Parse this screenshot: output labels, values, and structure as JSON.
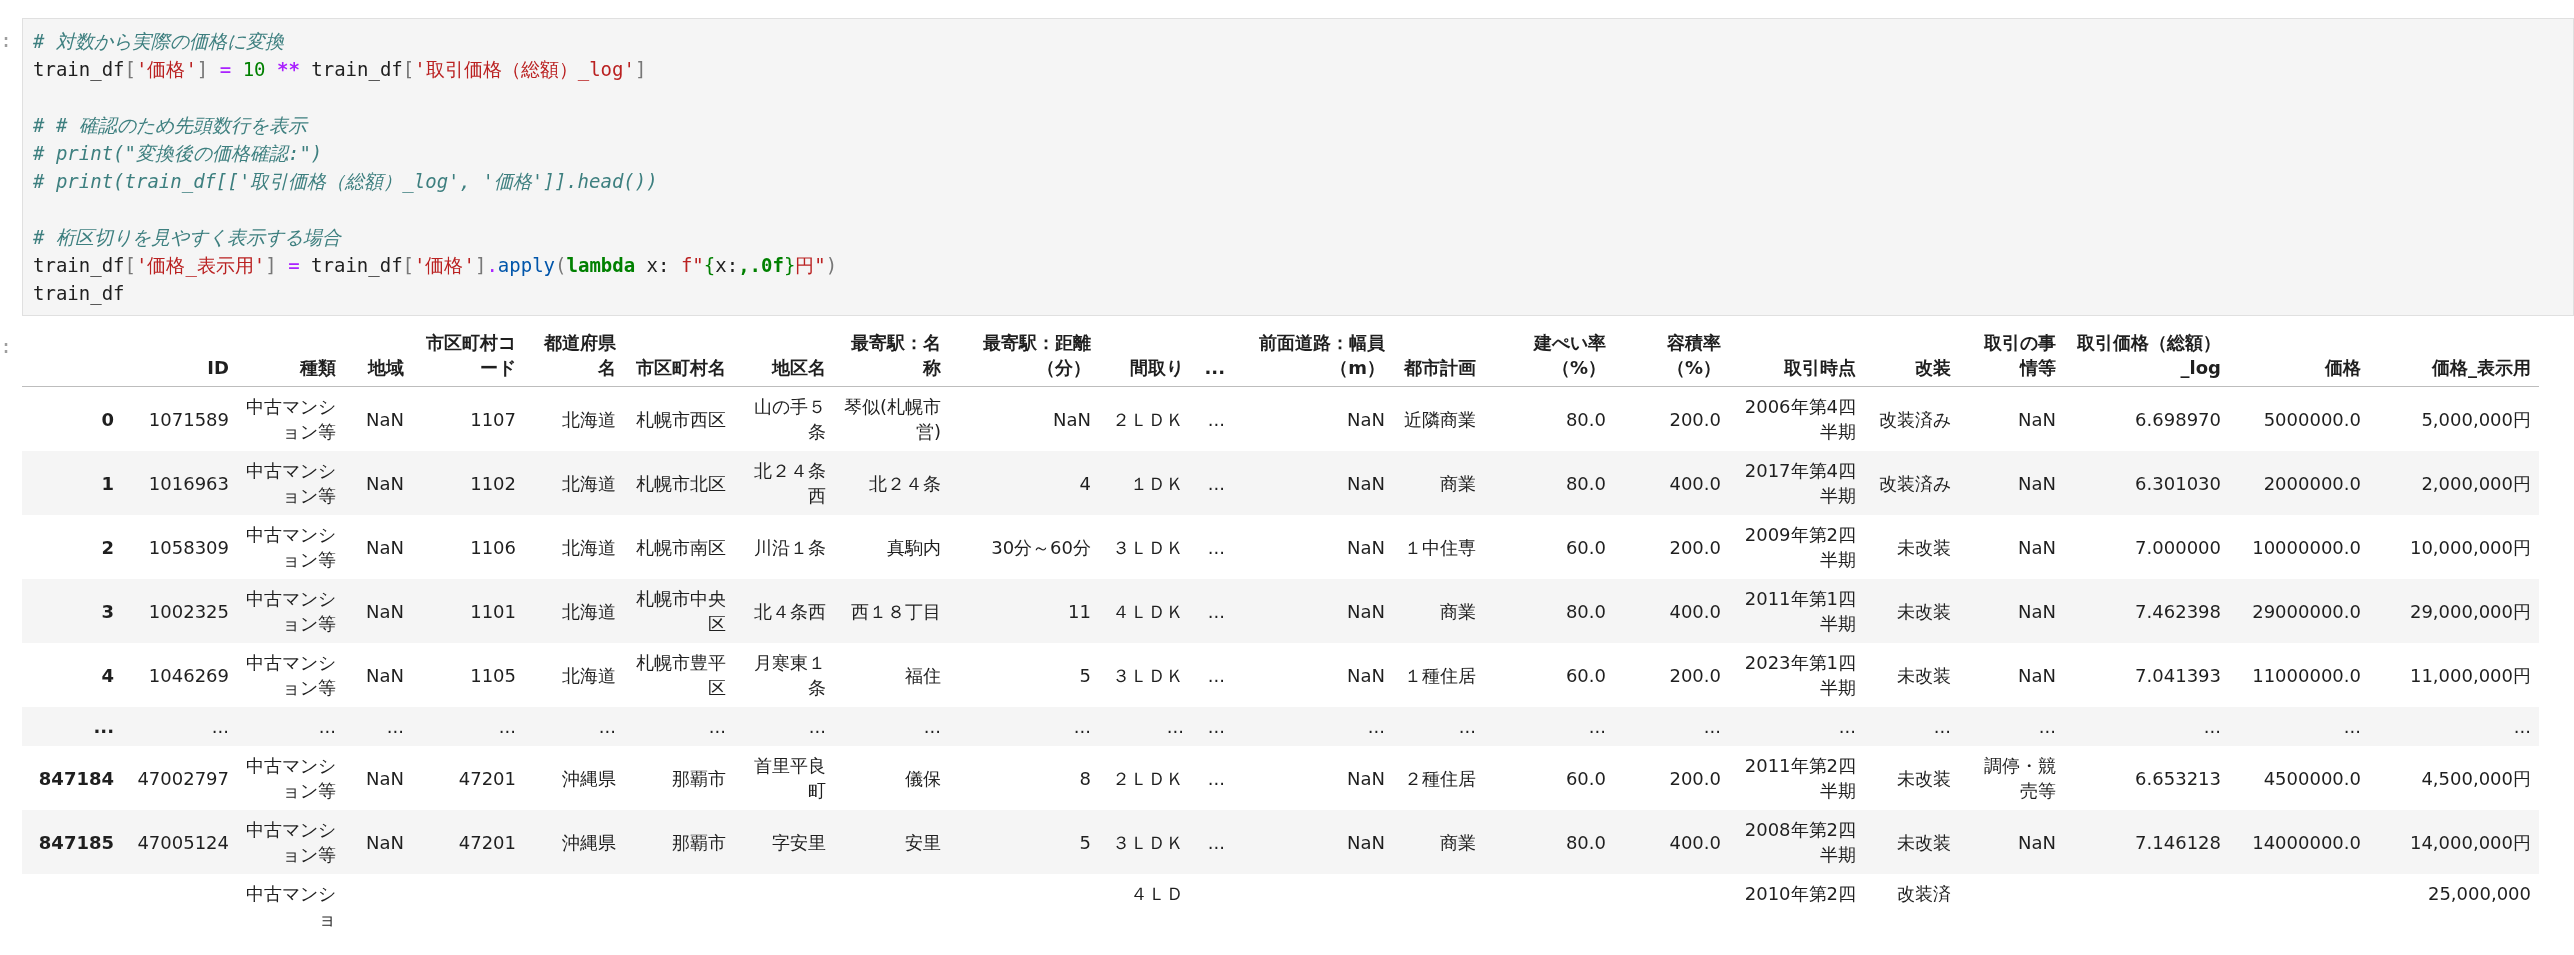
{
  "code_cell": {
    "prompt": ":",
    "lines": [
      {
        "kind": "code",
        "tokens": [
          {
            "kind": "comment",
            "text": "# 対数から実際の価格に変換"
          }
        ]
      },
      {
        "kind": "code",
        "tokens": [
          {
            "kind": "name",
            "text": "train_df"
          },
          {
            "kind": "punct",
            "text": "["
          },
          {
            "kind": "string",
            "text": "'価格'"
          },
          {
            "kind": "punct",
            "text": "]"
          },
          {
            "kind": "op",
            "text": " = "
          },
          {
            "kind": "number",
            "text": "10"
          },
          {
            "kind": "power",
            "text": " ** "
          },
          {
            "kind": "name",
            "text": "train_df"
          },
          {
            "kind": "punct",
            "text": "["
          },
          {
            "kind": "string",
            "text": "'取引価格（総額）_log'"
          },
          {
            "kind": "punct",
            "text": "]"
          }
        ]
      },
      {
        "kind": "blank"
      },
      {
        "kind": "code",
        "tokens": [
          {
            "kind": "comment",
            "text": "# # 確認のため先頭数行を表示"
          }
        ]
      },
      {
        "kind": "code",
        "tokens": [
          {
            "kind": "comment",
            "text": "# print(\"変換後の価格確認:\")"
          }
        ]
      },
      {
        "kind": "code",
        "tokens": [
          {
            "kind": "comment",
            "text": "# print(train_df[['取引価格（総額）_log', '価格']].head())"
          }
        ]
      },
      {
        "kind": "blank"
      },
      {
        "kind": "code",
        "tokens": [
          {
            "kind": "comment",
            "text": "# 桁区切りを見やすく表示する場合"
          }
        ]
      },
      {
        "kind": "code",
        "tokens": [
          {
            "kind": "name",
            "text": "train_df"
          },
          {
            "kind": "punct",
            "text": "["
          },
          {
            "kind": "string",
            "text": "'価格_表示用'"
          },
          {
            "kind": "punct",
            "text": "]"
          },
          {
            "kind": "op",
            "text": " = "
          },
          {
            "kind": "name",
            "text": "train_df"
          },
          {
            "kind": "punct",
            "text": "["
          },
          {
            "kind": "string",
            "text": "'価格'"
          },
          {
            "kind": "punct",
            "text": "]"
          },
          {
            "kind": "op",
            "text": "."
          },
          {
            "kind": "attr",
            "text": "apply"
          },
          {
            "kind": "punct",
            "text": "("
          },
          {
            "kind": "keyword",
            "text": "lambda"
          },
          {
            "kind": "name",
            "text": " x: "
          },
          {
            "kind": "string",
            "text": "f\""
          },
          {
            "kind": "interp",
            "text": "{"
          },
          {
            "kind": "name",
            "text": "x:"
          },
          {
            "kind": "format",
            "text": ",.0f"
          },
          {
            "kind": "interp",
            "text": "}"
          },
          {
            "kind": "string",
            "text": "円\""
          },
          {
            "kind": "punct",
            "text": ")"
          }
        ]
      },
      {
        "kind": "code",
        "tokens": [
          {
            "kind": "name",
            "text": "train_df"
          }
        ]
      }
    ]
  },
  "output": {
    "prompt": ":",
    "table": {
      "columns": [
        "ID",
        "種類",
        "地域",
        "市区町村コード",
        "都道府県名",
        "市区町村名",
        "地区名",
        "最寄駅：名称",
        "最寄駅：距離（分）",
        "間取り",
        "...",
        "前面道路：幅員（m）",
        "都市計画",
        "建ぺい率（%）",
        "容積率（%）",
        "取引時点",
        "改装",
        "取引の事情等",
        "取引価格（総額）_log",
        "価格",
        "価格_表示用"
      ],
      "rows": [
        {
          "cut_off": false,
          "index": "0",
          "cells": [
            "1071589",
            "中古マンション等",
            "NaN",
            "1107",
            "北海道",
            "札幌市西区",
            "山の手５条",
            "琴似(札幌市営)",
            "NaN",
            "２ＬＤＫ",
            "...",
            "NaN",
            "近隣商業",
            "80.0",
            "200.0",
            "2006年第4四半期",
            "改装済み",
            "NaN",
            "6.698970",
            "5000000.0",
            "5,000,000円"
          ]
        },
        {
          "cut_off": false,
          "index": "1",
          "cells": [
            "1016963",
            "中古マンション等",
            "NaN",
            "1102",
            "北海道",
            "札幌市北区",
            "北２４条西",
            "北２４条",
            "4",
            "１ＤＫ",
            "...",
            "NaN",
            "商業",
            "80.0",
            "400.0",
            "2017年第4四半期",
            "改装済み",
            "NaN",
            "6.301030",
            "2000000.0",
            "2,000,000円"
          ]
        },
        {
          "cut_off": false,
          "index": "2",
          "cells": [
            "1058309",
            "中古マンション等",
            "NaN",
            "1106",
            "北海道",
            "札幌市南区",
            "川沿１条",
            "真駒内",
            "30分～60分",
            "３ＬＤＫ",
            "...",
            "NaN",
            "１中住専",
            "60.0",
            "200.0",
            "2009年第2四半期",
            "未改装",
            "NaN",
            "7.000000",
            "10000000.0",
            "10,000,000円"
          ]
        },
        {
          "cut_off": false,
          "index": "3",
          "cells": [
            "1002325",
            "中古マンション等",
            "NaN",
            "1101",
            "北海道",
            "札幌市中央区",
            "北４条西",
            "西１８丁目",
            "11",
            "４ＬＤＫ",
            "...",
            "NaN",
            "商業",
            "80.0",
            "400.0",
            "2011年第1四半期",
            "未改装",
            "NaN",
            "7.462398",
            "29000000.0",
            "29,000,000円"
          ]
        },
        {
          "cut_off": false,
          "index": "4",
          "cells": [
            "1046269",
            "中古マンション等",
            "NaN",
            "1105",
            "北海道",
            "札幌市豊平区",
            "月寒東１条",
            "福住",
            "5",
            "３ＬＤＫ",
            "...",
            "NaN",
            "１種住居",
            "60.0",
            "200.0",
            "2023年第1四半期",
            "未改装",
            "NaN",
            "7.041393",
            "11000000.0",
            "11,000,000円"
          ]
        },
        {
          "cut_off": false,
          "index": "...",
          "cells": [
            "...",
            "...",
            "...",
            "...",
            "...",
            "...",
            "...",
            "...",
            "...",
            "...",
            "...",
            "...",
            "...",
            "...",
            "...",
            "...",
            "...",
            "...",
            "...",
            "...",
            "..."
          ]
        },
        {
          "cut_off": false,
          "index": "847184",
          "cells": [
            "47002797",
            "中古マンション等",
            "NaN",
            "47201",
            "沖縄県",
            "那覇市",
            "首里平良町",
            "儀保",
            "8",
            "２ＬＤＫ",
            "...",
            "NaN",
            "２種住居",
            "60.0",
            "200.0",
            "2011年第2四半期",
            "未改装",
            "調停・競売等",
            "6.653213",
            "4500000.0",
            "4,500,000円"
          ]
        },
        {
          "cut_off": false,
          "index": "847185",
          "cells": [
            "47005124",
            "中古マンション等",
            "NaN",
            "47201",
            "沖縄県",
            "那覇市",
            "字安里",
            "安里",
            "5",
            "３ＬＤＫ",
            "...",
            "NaN",
            "商業",
            "80.0",
            "400.0",
            "2008年第2四半期",
            "未改装",
            "NaN",
            "7.146128",
            "14000000.0",
            "14,000,000円"
          ]
        },
        {
          "cut_off": true,
          "cells": [
            null,
            "中古マンショ",
            null,
            null,
            null,
            null,
            null,
            null,
            null,
            "４ＬＤ",
            null,
            null,
            null,
            null,
            null,
            "2010年第2四",
            "改装済",
            null,
            null,
            null,
            "25,000,000"
          ]
        }
      ]
    }
  }
}
